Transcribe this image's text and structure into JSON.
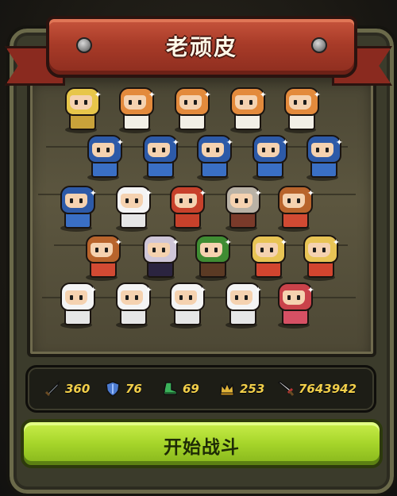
{
  "header": {
    "title": "老顽皮"
  },
  "stats": [
    {
      "icon": "sword-icon",
      "value": "360",
      "color": "#9fb7c9"
    },
    {
      "icon": "shield-icon",
      "value": "76",
      "color": "#4c7bd0"
    },
    {
      "icon": "boot-icon",
      "value": "69",
      "color": "#3bb25a"
    },
    {
      "icon": "crown-icon",
      "value": "253",
      "color": "#e3b63a"
    },
    {
      "icon": "power-sword-icon",
      "value": "7643942",
      "color": "#d6d6d6"
    }
  ],
  "actions": {
    "start_label": "开始战斗"
  },
  "colors": {
    "ribbon": "#a83b28",
    "panel": "#3b3b2b",
    "button": "#a6d52a",
    "stat_text": "#f2cf4a"
  }
}
